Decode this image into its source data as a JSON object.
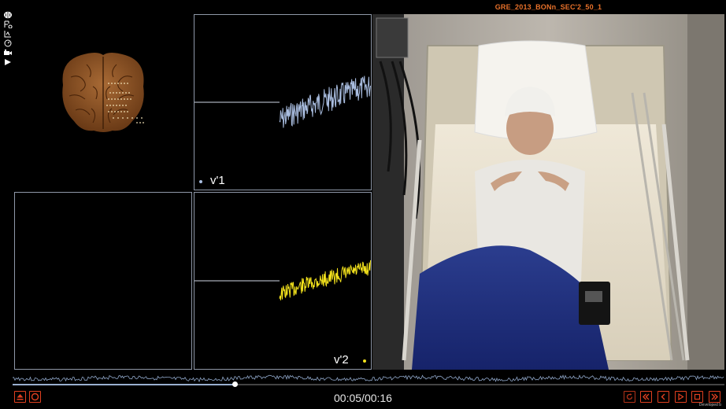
{
  "toolbar": {
    "icons": [
      "brain-icon",
      "scene-icon",
      "graph-icon",
      "gauge-icon",
      "camera-icon",
      "play-icon"
    ]
  },
  "video": {
    "title": "GRE_2013_BONn_SEC'2_50_1"
  },
  "channels": [
    {
      "label": "v'1",
      "color": "#a9bde0"
    },
    {
      "label": "v'2",
      "color": "#f2e11c"
    }
  ],
  "playback": {
    "current_time": "00:05",
    "separator": "/",
    "total_time": "00:16",
    "progress": 0.3125
  },
  "footer": {
    "credit": "Developed b"
  },
  "colors": {
    "accent": "#e04020",
    "panel_border": "#8f98a8",
    "brain": "#8a5022"
  }
}
